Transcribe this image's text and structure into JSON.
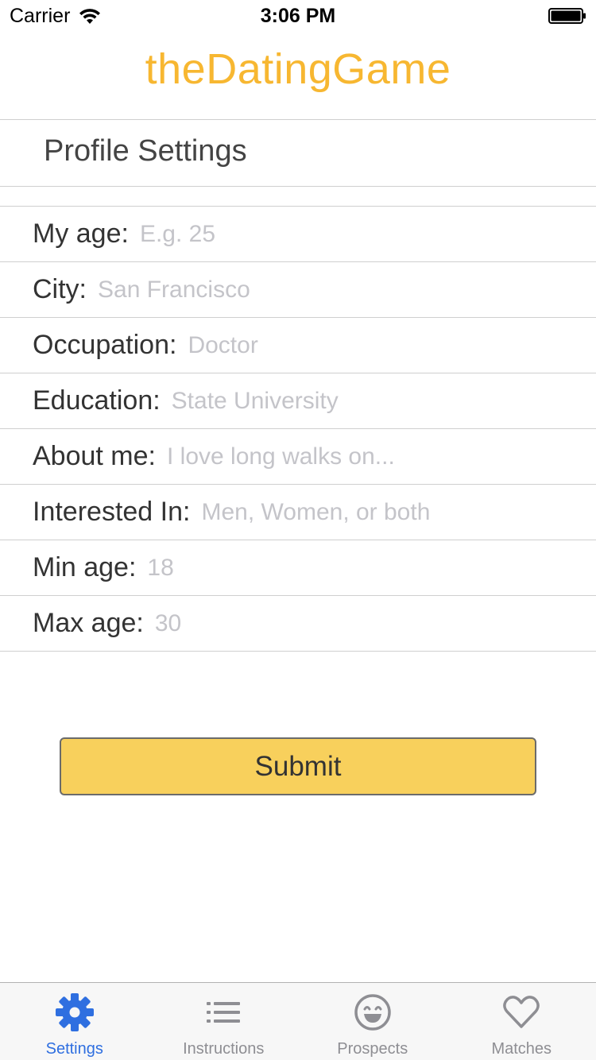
{
  "status_bar": {
    "carrier": "Carrier",
    "time": "3:06 PM"
  },
  "app": {
    "title": "theDatingGame"
  },
  "section": {
    "title": "Profile Settings"
  },
  "form": {
    "fields": [
      {
        "label": "My age:",
        "placeholder": "E.g. 25",
        "value": ""
      },
      {
        "label": "City:",
        "placeholder": "San Francisco",
        "value": ""
      },
      {
        "label": "Occupation:",
        "placeholder": "Doctor",
        "value": ""
      },
      {
        "label": "Education:",
        "placeholder": "State University",
        "value": ""
      },
      {
        "label": "About me:",
        "placeholder": "I love long walks on...",
        "value": ""
      },
      {
        "label": "Interested In:",
        "placeholder": "Men, Women, or both",
        "value": ""
      },
      {
        "label": "Min age:",
        "placeholder": "18",
        "value": ""
      },
      {
        "label": "Max age:",
        "placeholder": "30",
        "value": ""
      }
    ],
    "submit_label": "Submit"
  },
  "tab_bar": {
    "tabs": [
      {
        "label": "Settings",
        "icon": "gear-icon",
        "active": true
      },
      {
        "label": "Instructions",
        "icon": "list-icon",
        "active": false
      },
      {
        "label": "Prospects",
        "icon": "smiley-icon",
        "active": false
      },
      {
        "label": "Matches",
        "icon": "heart-icon",
        "active": false
      }
    ]
  },
  "colors": {
    "brand": "#f7b731",
    "submit_fill": "#f8d05c",
    "active_tab": "#2f6fe0",
    "inactive_tab": "#8e8e93",
    "placeholder": "#c4c4c9"
  }
}
